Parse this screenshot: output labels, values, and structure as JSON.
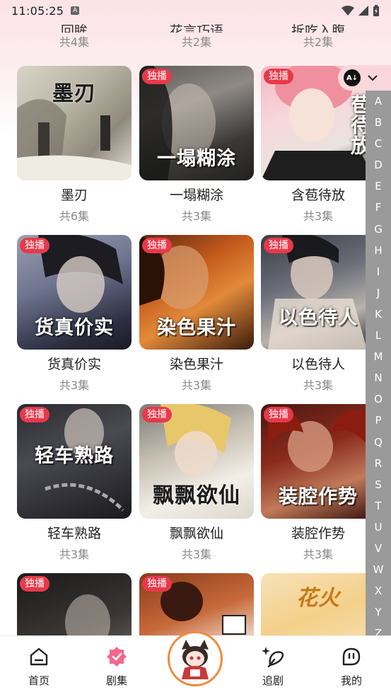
{
  "status": {
    "time": "11:05:25"
  },
  "partial_row": [
    {
      "title": "回眸",
      "count": "共4集"
    },
    {
      "title": "花言巧语",
      "count": "共2集"
    },
    {
      "title": "拆吃入腹",
      "count": "共2集"
    }
  ],
  "exclusive_label": "独播",
  "grid": [
    {
      "title": "墨刃",
      "count": "共6集",
      "exclusive": false,
      "cover_text": "墨刃"
    },
    {
      "title": "一塌糊涂",
      "count": "共3集",
      "exclusive": true,
      "cover_text": "一塌糊涂"
    },
    {
      "title": "含苞待放",
      "count": "共3集",
      "exclusive": true,
      "cover_text": "苞待放"
    },
    {
      "title": "货真价实",
      "count": "共3集",
      "exclusive": true,
      "cover_text": "货真价实"
    },
    {
      "title": "染色果汁",
      "count": "共3集",
      "exclusive": true,
      "cover_text": "染色果汁"
    },
    {
      "title": "以色待人",
      "count": "共3集",
      "exclusive": true,
      "cover_text": "以色待人"
    },
    {
      "title": "轻车熟路",
      "count": "共3集",
      "exclusive": true,
      "cover_text": "轻车熟路"
    },
    {
      "title": "飘飘欲仙",
      "count": "共3集",
      "exclusive": true,
      "cover_text": "飘飘欲仙"
    },
    {
      "title": "装腔作势",
      "count": "共3集",
      "exclusive": true,
      "cover_text": "装腔作势"
    },
    {
      "title": "",
      "count": "",
      "exclusive": true,
      "cover_text": ""
    },
    {
      "title": "",
      "count": "",
      "exclusive": true,
      "cover_text": ""
    },
    {
      "title": "",
      "count": "",
      "exclusive": false,
      "cover_text": "花火"
    }
  ],
  "alphabet": [
    "A",
    "B",
    "C",
    "D",
    "E",
    "F",
    "G",
    "H",
    "I",
    "J",
    "K",
    "L",
    "M",
    "N",
    "O",
    "P",
    "Q",
    "R",
    "S",
    "T",
    "U",
    "V",
    "W",
    "X",
    "Y",
    "Z"
  ],
  "nav": {
    "home": "首页",
    "series": "剧集",
    "follow": "追剧",
    "mine": "我的"
  },
  "colors": {
    "accent": "#e7394a",
    "index_bar": "#9a9a9a",
    "avatar_ring": "#f08a3c"
  }
}
